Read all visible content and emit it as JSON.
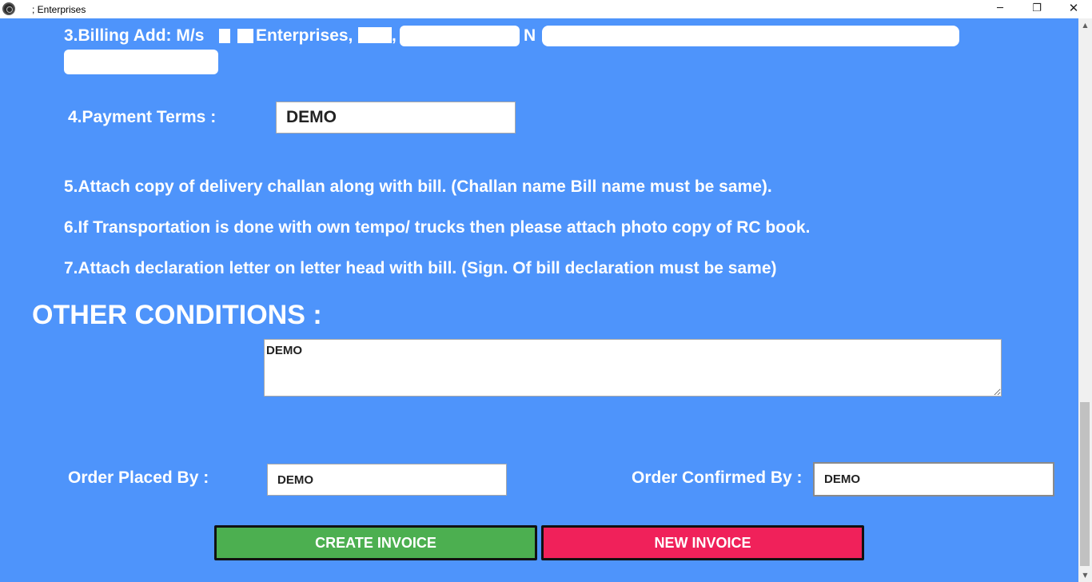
{
  "window": {
    "title": "; Enterprises",
    "minimize_icon": "─",
    "restore_icon": "❐",
    "close_icon": "✕"
  },
  "billing": {
    "label": "3.Billing Add: M/s",
    "company_fragment": "Enterprises,",
    "sep": ",",
    "name_prefix": "N"
  },
  "payment": {
    "label": "4.Payment Terms :",
    "value": "DEMO"
  },
  "instructions": [
    "5.Attach copy of delivery challan along with bill. (Challan name  Bill name must be same).",
    "6.If Transportation is done with own tempo/ trucks then please attach photo copy of RC book.",
    "7.Attach declaration letter on letter head with bill. (Sign. Of bill  declaration must be same)"
  ],
  "other_conditions": {
    "heading": "OTHER CONDITIONS :",
    "value": "DEMO"
  },
  "order_placed": {
    "label": "Order Placed By :",
    "value": "DEMO"
  },
  "order_confirmed": {
    "label": "Order Confirmed By :",
    "value": "DEMO"
  },
  "buttons": {
    "create": "CREATE  INVOICE",
    "new": "NEW  INVOICE"
  },
  "scrollbar": {
    "up_icon": "▲",
    "down_icon": "▼"
  },
  "colors": {
    "background": "#4e94fb",
    "create_button": "#4caf50",
    "new_button": "#f0215a"
  }
}
